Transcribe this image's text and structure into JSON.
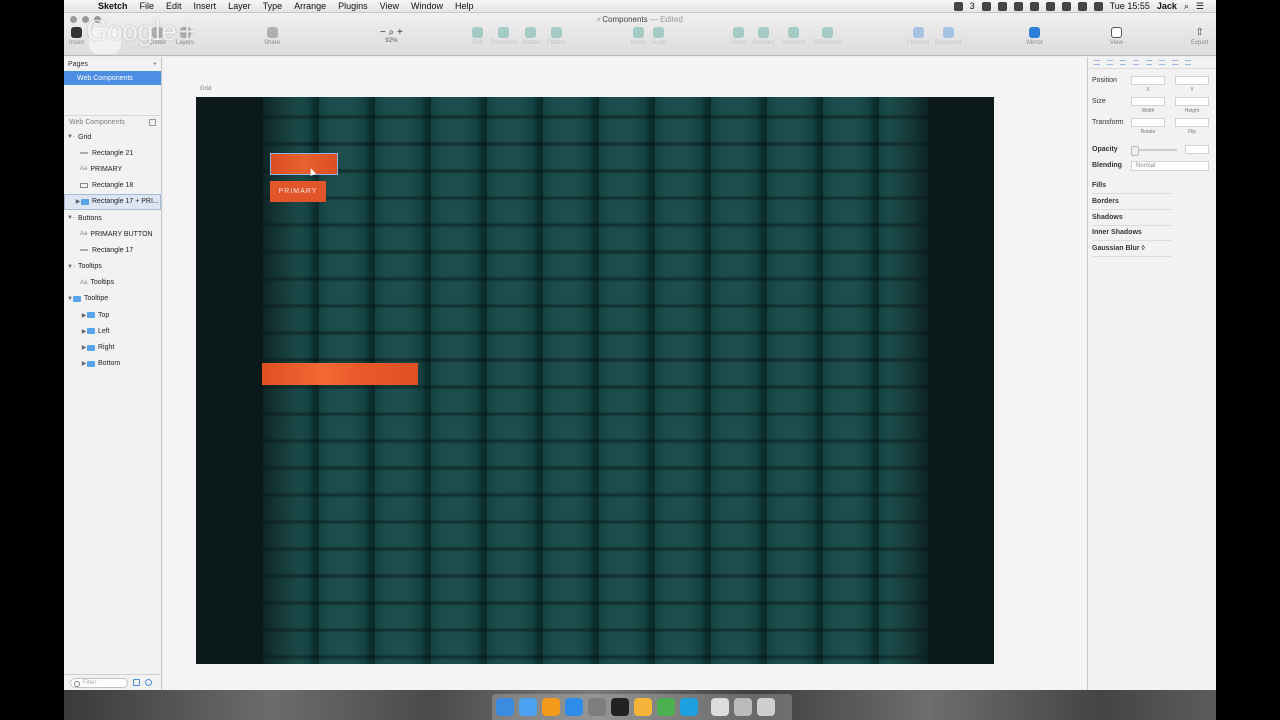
{
  "menubar": {
    "app": "Sketch",
    "items": [
      "File",
      "Edit",
      "Insert",
      "Layer",
      "Type",
      "Arrange",
      "Plugins",
      "View",
      "Window",
      "Help"
    ],
    "status": {
      "notifications": "3",
      "time": "Tue 15:55",
      "user": "Jack"
    }
  },
  "window": {
    "title": "Components",
    "edited": "— Edited"
  },
  "toolbar": {
    "insert": "Insert",
    "create": "Create",
    "layers": "Layers",
    "share": "Share",
    "zoom": "92%",
    "edit": "Edit",
    "transform": "Transform",
    "rotate": "Rotate",
    "flatten": "Flatten",
    "mask": "Mask",
    "scale": "Scale",
    "union": "Union",
    "subtract": "Subtract",
    "intersect": "Intersect",
    "difference": "Difference",
    "forward": "Forward",
    "backward": "Backward",
    "mirror": "Mirror",
    "view": "View",
    "export": "Export"
  },
  "watermark": {
    "text": "Google+"
  },
  "sidebar": {
    "pages_header": "Pages",
    "add": "+",
    "selected_page": "Web Components",
    "layers_header": "Web Components",
    "layers": [
      {
        "label": "Grid",
        "indent": 0,
        "type": "group",
        "tri": "▼"
      },
      {
        "label": "Rectangle 21",
        "indent": 1,
        "type": "rect"
      },
      {
        "label": "PRIMARY",
        "indent": 1,
        "type": "text"
      },
      {
        "label": "Rectangle 18",
        "indent": 1,
        "type": "rectbox"
      },
      {
        "label": "Rectangle 17 + PRI...",
        "indent": 1,
        "type": "folder",
        "tri": "▶",
        "selected": true
      },
      {
        "label": "Buttons",
        "indent": 0,
        "type": "group",
        "tri": "▼"
      },
      {
        "label": "PRIMARY BUTTON",
        "indent": 1,
        "type": "text"
      },
      {
        "label": "Rectangle 17",
        "indent": 1,
        "type": "rect"
      },
      {
        "label": "Tooltips",
        "indent": 0,
        "type": "group",
        "tri": "▼"
      },
      {
        "label": "Tooltips",
        "indent": 1,
        "type": "text"
      },
      {
        "label": "Tooltipe",
        "indent": 0,
        "type": "folder",
        "tri": "▼"
      },
      {
        "label": "Top",
        "indent": 2,
        "type": "folder",
        "tri": "▶"
      },
      {
        "label": "Left",
        "indent": 2,
        "type": "folder",
        "tri": "▶"
      },
      {
        "label": "Right",
        "indent": 2,
        "type": "folder",
        "tri": "▶"
      },
      {
        "label": "Bottom",
        "indent": 2,
        "type": "folder",
        "tri": "▶"
      }
    ],
    "filter_placeholder": "Filter"
  },
  "canvas": {
    "artboard_label": "Grid",
    "button_label": "PRIMARY",
    "accent": "#e2542a",
    "grid_color": "#1d4d4c",
    "artboard_bg": "#0b191a"
  },
  "inspector": {
    "position": "Position",
    "x": "X",
    "y": "Y",
    "size": "Size",
    "width": "Width",
    "height": "Height",
    "transform": "Transform",
    "rotate": "Rotate",
    "flip": "Flip",
    "opacity": "Opacity",
    "blending": "Blending",
    "blend_value": "Normal",
    "fills": "Fills",
    "borders": "Borders",
    "shadows": "Shadows",
    "inner_shadows": "Inner Shadows",
    "gaussian_blur": "Gaussian Blur ◊"
  },
  "dock": {
    "apps": [
      {
        "name": "finder-icon",
        "color": "#3b8be0"
      },
      {
        "name": "messages-icon",
        "color": "#4aa3f0"
      },
      {
        "name": "ibooks-icon",
        "color": "#f39a1d"
      },
      {
        "name": "app-store-icon",
        "color": "#2e8de8"
      },
      {
        "name": "system-preferences-icon",
        "color": "#7d7d7d"
      },
      {
        "name": "sonos-icon",
        "color": "#222222"
      },
      {
        "name": "sketch-icon",
        "color": "#f4b63a"
      },
      {
        "name": "chrome-icon",
        "color": "#4caf50"
      },
      {
        "name": "skype-icon",
        "color": "#1ea0e0"
      },
      {
        "name": "folder-icon",
        "color": "#dcdcdc"
      },
      {
        "name": "downloads-icon",
        "color": "#bbbbbb"
      },
      {
        "name": "trash-icon",
        "color": "#cfcfcf"
      }
    ]
  }
}
